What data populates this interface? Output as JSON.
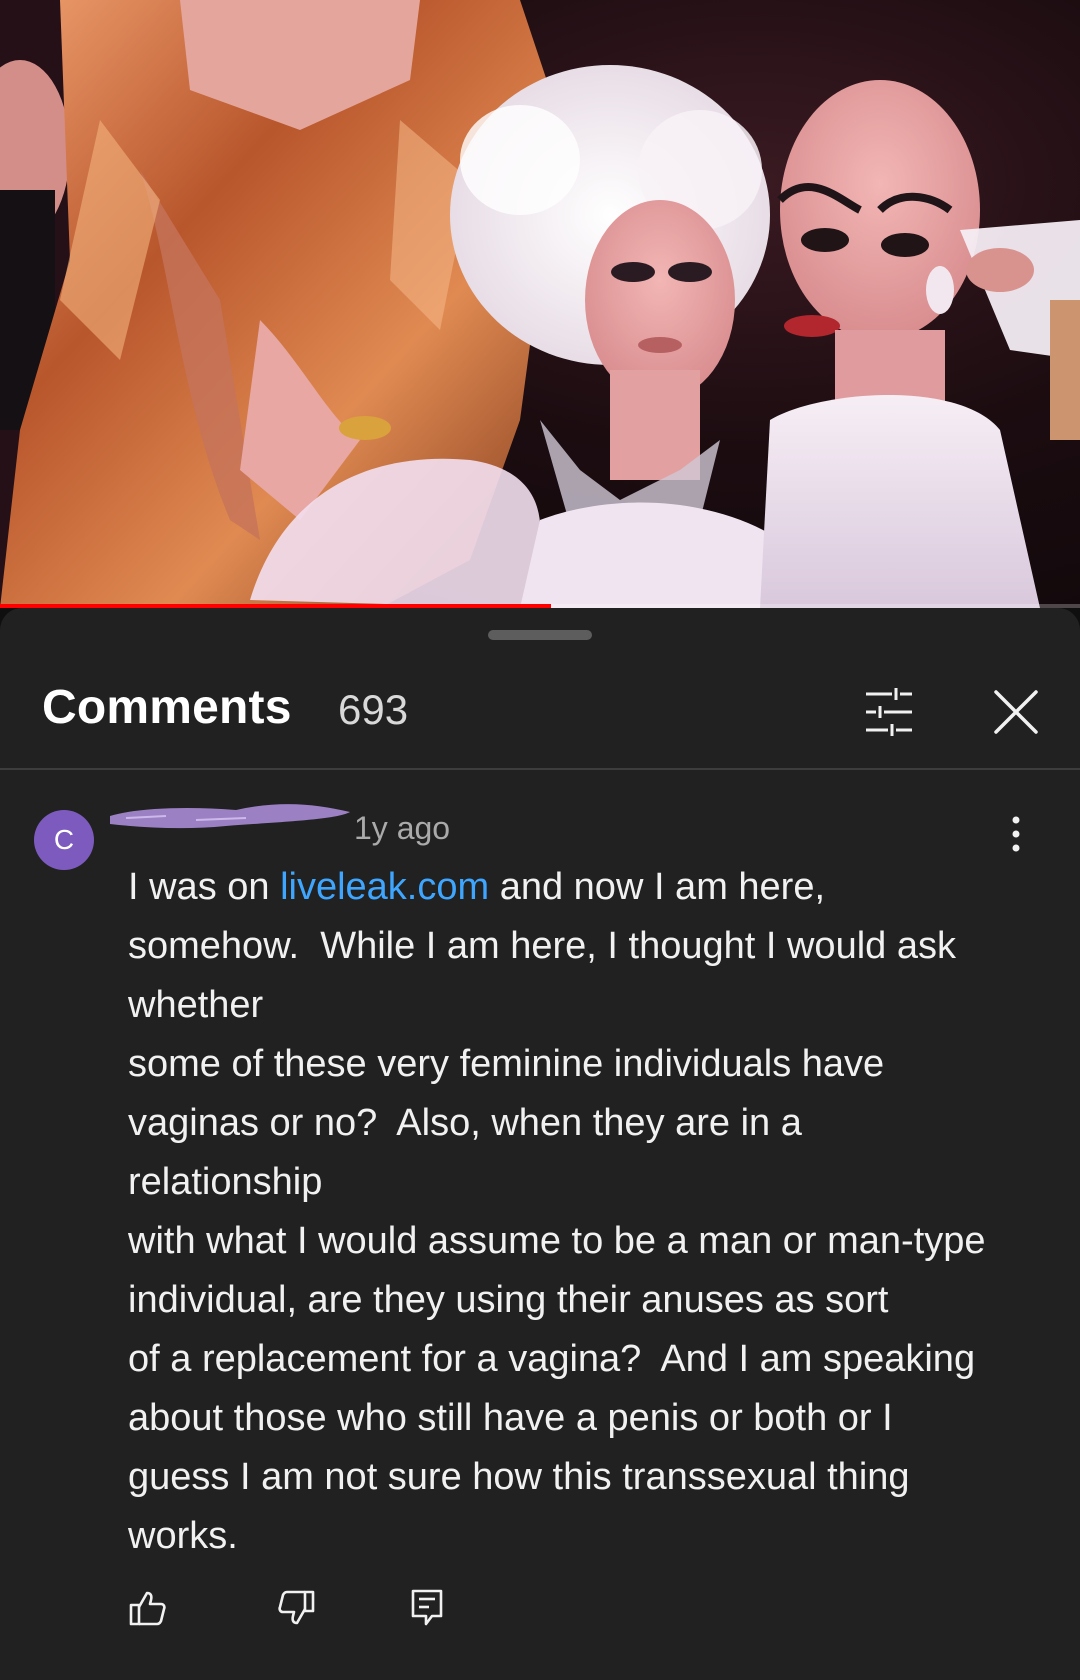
{
  "video": {
    "progress_fraction": 0.51
  },
  "comments_panel": {
    "title": "Comments",
    "count": "693",
    "filter_icon": "sliders-icon",
    "close_icon": "close-icon"
  },
  "comment": {
    "avatar_letter": "C",
    "author_redacted": true,
    "timestamp": "1y ago",
    "menu_icon": "more-vertical-icon",
    "lines": {
      "l1_pre": "I was on ",
      "l1_link": "liveleak.com",
      "l1_post": " and now I am here,",
      "l2": "somehow.  While I am here, I thought I would ask",
      "l3": "whether",
      "l4": "some of these very feminine individuals have",
      "l5": "vaginas or no?  Also, when they are in a",
      "l6": "relationship",
      "l7": "with what I would assume to be a man or man-type",
      "l8": "individual, are they using their anuses as sort",
      "l9": "of a replacement for a vagina?  And I am speaking",
      "l10": "about those who still have a penis or both or I",
      "l11": "guess I am not sure how this transsexual thing",
      "l12": "works."
    },
    "actions": {
      "like_icon": "thumbs-up-icon",
      "dislike_icon": "thumbs-down-icon",
      "reply_icon": "reply-icon"
    }
  },
  "colors": {
    "sheet_bg": "#212121",
    "link": "#3ea6ff",
    "avatar": "#7d5bbe",
    "progress": "#ff0000"
  }
}
